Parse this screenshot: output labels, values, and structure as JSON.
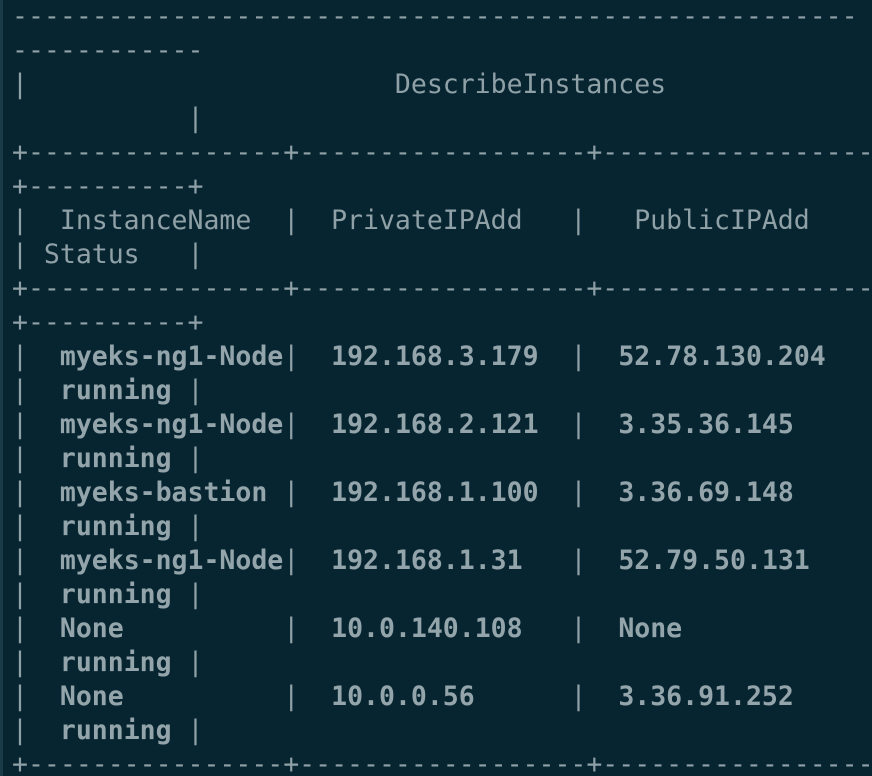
{
  "terminal": {
    "title_border_top": "-----------------------------------------------------",
    "title_border_top_wrap": "------------",
    "title_line": "|                       DescribeInstances",
    "title_line_wrap": "           |",
    "separator": "+----------------+------------------+-----------------",
    "separator_wrap": "+----------+",
    "header_line": "|  InstanceName  |  PrivateIPAdd   |   PublicIPAdd",
    "header_line_wrap": "| Status   |",
    "rows": [
      {
        "name": "myeks-ng1-Node",
        "private_ip": "192.168.3.179",
        "public_ip": "52.78.130.204",
        "status": "running"
      },
      {
        "name": "myeks-ng1-Node",
        "private_ip": "192.168.2.121",
        "public_ip": "3.35.36.145",
        "status": "running"
      },
      {
        "name": "myeks-bastion",
        "private_ip": "192.168.1.100",
        "public_ip": "3.36.69.148",
        "status": "running"
      },
      {
        "name": "myeks-ng1-Node",
        "private_ip": "192.168.1.31",
        "public_ip": "52.79.50.131",
        "status": "running"
      },
      {
        "name": "None",
        "private_ip": "10.0.140.108",
        "public_ip": "None",
        "status": "running"
      },
      {
        "name": "None",
        "private_ip": "10.0.0.56",
        "public_ip": "3.36.91.252",
        "status": "running"
      }
    ]
  }
}
